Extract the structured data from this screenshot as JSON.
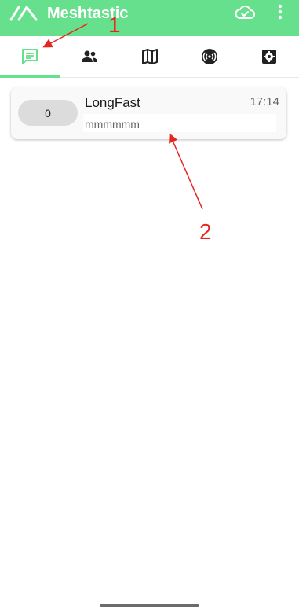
{
  "app": {
    "title": "Meshtastic",
    "brand_color": "#67E08D",
    "logo_icon": "meshtastic-logo-icon",
    "cloud_icon": "cloud-check-icon",
    "overflow_icon": "more-vert-icon"
  },
  "tabs": [
    {
      "name": "tab-messages",
      "icon": "chat-icon",
      "active": true
    },
    {
      "name": "tab-nodes",
      "icon": "people-icon",
      "active": false
    },
    {
      "name": "tab-map",
      "icon": "map-icon",
      "active": false
    },
    {
      "name": "tab-channel",
      "icon": "radio-signal-icon",
      "active": false
    },
    {
      "name": "tab-settings",
      "icon": "settings-icon",
      "active": false
    }
  ],
  "channels": [
    {
      "index": "0",
      "name": "LongFast",
      "time": "17:14",
      "preview": "mmmmmm"
    }
  ],
  "annotations": [
    {
      "label": "1",
      "color": "#E5261E"
    },
    {
      "label": "2",
      "color": "#E5261E"
    }
  ]
}
